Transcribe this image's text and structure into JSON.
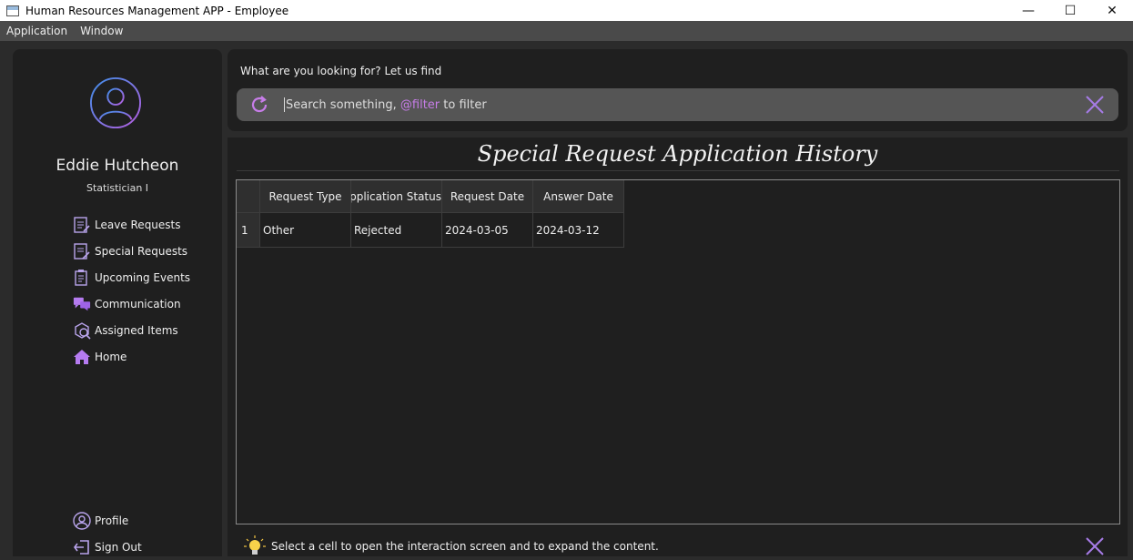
{
  "window": {
    "title": "Human Resources Management APP - Employee"
  },
  "menu": {
    "items": [
      "Application",
      "Window"
    ]
  },
  "sidebar": {
    "user_name": "Eddie Hutcheon",
    "user_role": "Statistician I",
    "items": [
      {
        "label": "Leave Requests",
        "icon": "leave-requests-icon"
      },
      {
        "label": "Special Requests",
        "icon": "special-requests-icon"
      },
      {
        "label": "Upcoming Events",
        "icon": "upcoming-events-icon"
      },
      {
        "label": "Communication",
        "icon": "communication-icon"
      },
      {
        "label": "Assigned Items",
        "icon": "assigned-items-icon"
      },
      {
        "label": "Home",
        "icon": "home-icon"
      }
    ],
    "bottom_items": [
      {
        "label": "Profile",
        "icon": "profile-icon"
      },
      {
        "label": "Sign Out",
        "icon": "sign-out-icon"
      }
    ]
  },
  "search": {
    "heading": "What are you looking for? Let us find",
    "placeholder_prefix": "Search something, ",
    "placeholder_accent": "@filter",
    "placeholder_suffix": " to filter"
  },
  "main": {
    "title": "Special Request Application History",
    "table": {
      "columns": [
        "Request Type",
        "Application Status",
        "Request Date",
        "Answer Date"
      ],
      "rows": [
        {
          "index": "1",
          "cells": [
            "Other",
            "Rejected",
            "2024-03-05",
            "2024-03-12"
          ]
        }
      ]
    },
    "status_text": "Select a cell to open the interaction screen and to expand the content."
  },
  "colors": {
    "accent": "#c77de8",
    "background": "#1f1f1f",
    "panel": "#2b2b2b"
  }
}
